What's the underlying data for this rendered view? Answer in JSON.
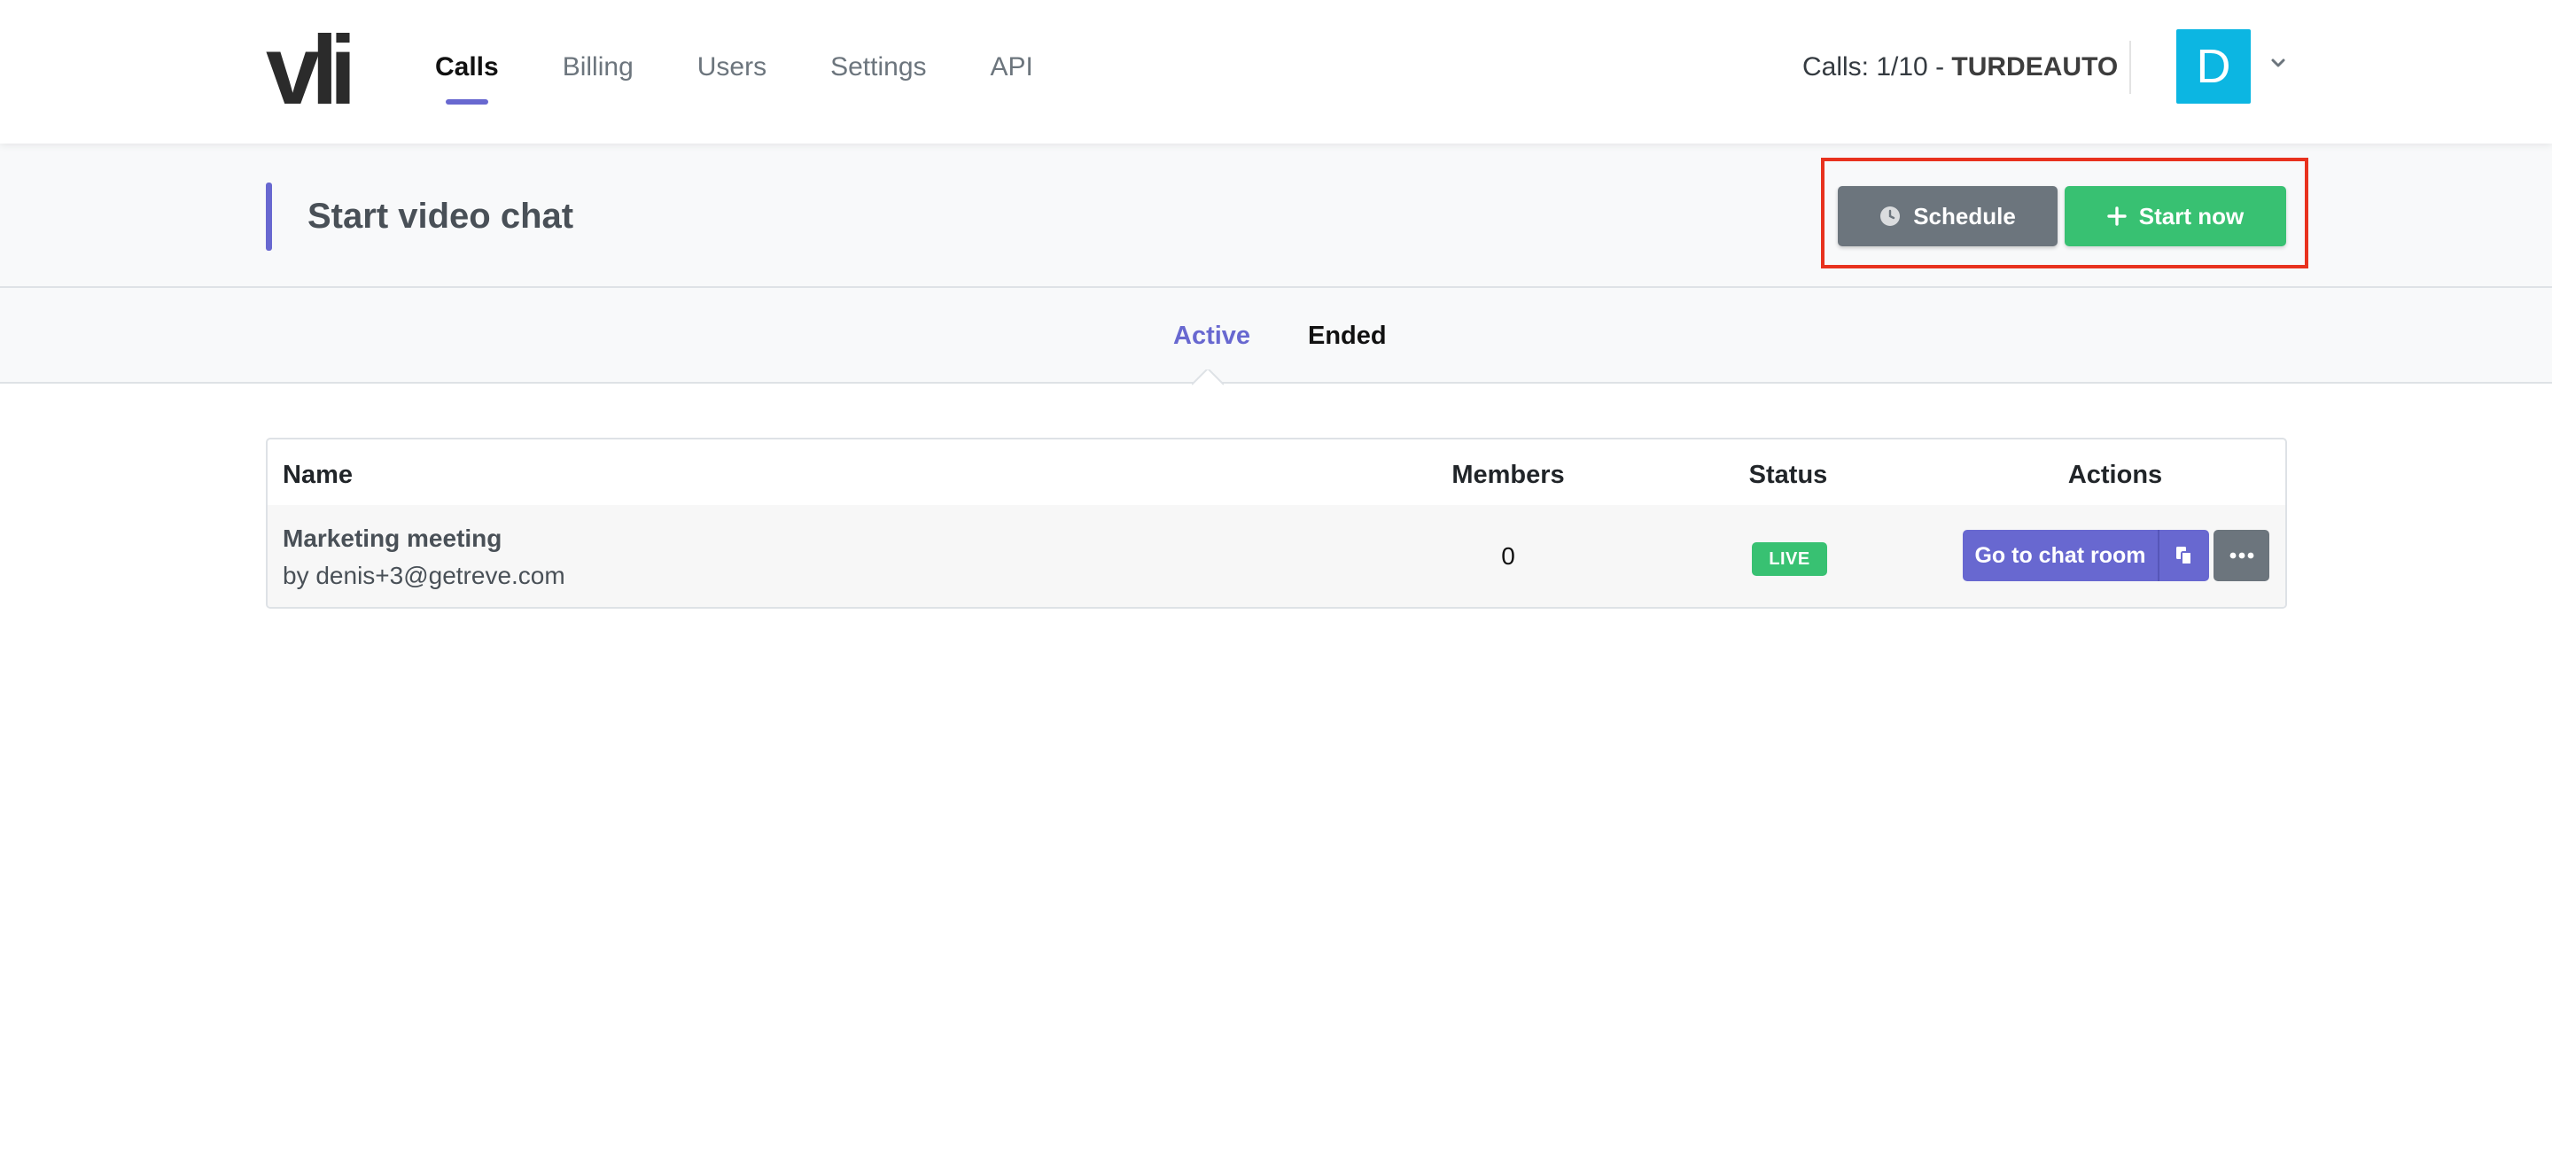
{
  "app": {
    "logo_text": "vli"
  },
  "nav": {
    "items": [
      {
        "label": "Calls",
        "active": true
      },
      {
        "label": "Billing",
        "active": false
      },
      {
        "label": "Users",
        "active": false
      },
      {
        "label": "Settings",
        "active": false
      },
      {
        "label": "API",
        "active": false
      }
    ],
    "usage_prefix": "Calls: 1/10 - ",
    "usage_account": "TURDEAUTO",
    "avatar_letter": "D",
    "avatar_color": "#0cb6e2",
    "avatar_dropdown_icon": "chevron-down-icon"
  },
  "header": {
    "title": "Start video chat",
    "schedule_label": "Schedule",
    "schedule_icon": "clock-icon",
    "start_label": "Start now",
    "start_icon": "plus-icon",
    "highlight_color": "#e8321e"
  },
  "tabs": [
    {
      "label": "Active",
      "active": true
    },
    {
      "label": "Ended",
      "active": false
    }
  ],
  "table": {
    "columns": [
      "Name",
      "Members",
      "Status",
      "Actions"
    ],
    "rows": [
      {
        "name": "Marketing meeting",
        "owner": "by denis+3@getreve.com",
        "members": "0",
        "status": "LIVE",
        "action_label": "Go to chat room",
        "copy_icon": "copy-icon",
        "more_icon": "more-icon"
      }
    ]
  },
  "colors": {
    "accent": "#6868d0",
    "success": "#38c172",
    "secondary": "#6c757d"
  }
}
